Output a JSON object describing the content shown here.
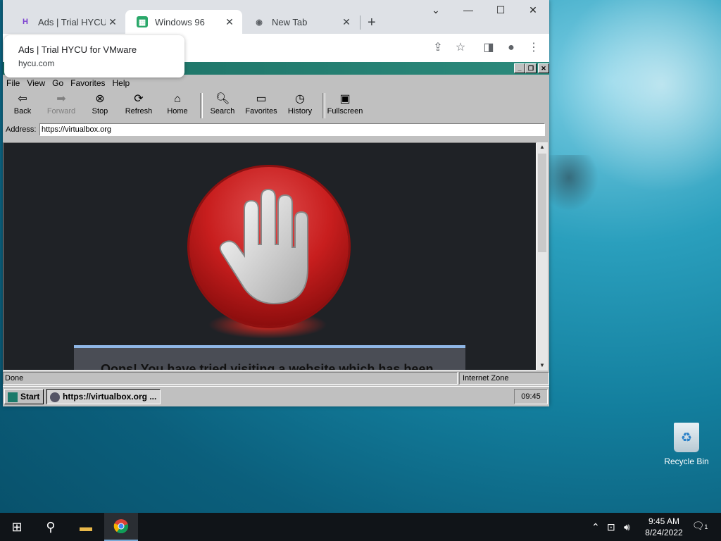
{
  "browser": {
    "tabs": [
      {
        "label": "Ads | Trial HYCU fo",
        "icon": "hycu-icon"
      },
      {
        "label": "Windows 96",
        "icon": "windows96-icon"
      },
      {
        "label": "New Tab",
        "icon": "chrome-icon"
      }
    ],
    "tooltip": {
      "title": "Ads | Trial HYCU for VMware",
      "url": "hycu.com"
    }
  },
  "win96_browser": {
    "menu": [
      "File",
      "View",
      "Go",
      "Favorites",
      "Help"
    ],
    "toolbar": {
      "back": "Back",
      "forward": "Forward",
      "stop": "Stop",
      "refresh": "Refresh",
      "home": "Home",
      "search": "Search",
      "favorites": "Favorites",
      "history": "History",
      "fullscreen": "Fullscreen"
    },
    "address_label": "Address:",
    "address_value": "https://virtualbox.org",
    "error_text": "Oops! You have tried visiting a website which has been",
    "status_left": "Done",
    "status_right": "Internet Zone"
  },
  "win96_taskbar": {
    "start_label": "Start",
    "task_item": "https://virtualbox.org ...",
    "clock": "09:45"
  },
  "desktop": {
    "recycle_bin_label": "Recycle Bin"
  },
  "taskbar": {
    "time": "9:45 AM",
    "date": "8/24/2022",
    "notifications": "1"
  }
}
